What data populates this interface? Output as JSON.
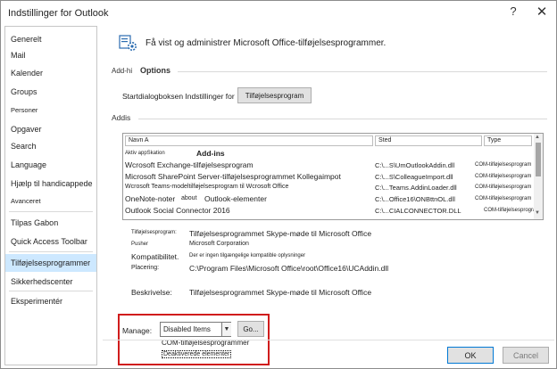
{
  "window": {
    "title": "Indstillinger for Outlook",
    "help_glyph": "?",
    "close_glyph": "✕"
  },
  "sidebar": {
    "items": [
      {
        "label": "Generelt"
      },
      {
        "label": "Mail"
      },
      {
        "label": "Kalender"
      },
      {
        "label": "Groups"
      },
      {
        "label": "Personer"
      },
      {
        "label": "Opgaver"
      },
      {
        "label": "Search"
      },
      {
        "label": "Language"
      },
      {
        "label": "Hjælp til handicappede"
      },
      {
        "label": "Avanceret"
      },
      {
        "label": "Tilpas Gabon"
      },
      {
        "label": "Quick Access Toolbar"
      },
      {
        "label": "Tilføjelsesprogrammer",
        "selected": true
      },
      {
        "label": "Sikkerhedscenter"
      },
      {
        "label": "Eksperimentér"
      }
    ]
  },
  "main": {
    "header": "Få vist og administrer Microsoft Office-tilføjelsesprogrammer.",
    "addin_section": {
      "prefix": "Add-hi",
      "label": "Options"
    },
    "startup": {
      "text": "Startdialogboksen Indstillinger for",
      "button_label": "Tilføjelsesprogram"
    },
    "addins_section_label": "Addis",
    "list": {
      "columns": {
        "name": "Navn A",
        "location": "Sted",
        "type": "Type"
      },
      "group": {
        "prefix": "Aktiv appSkation",
        "label": "Add-ins"
      },
      "rows": [
        {
          "name": "Wcrosoft Exchange-tilføjelsesprogram",
          "location": "C:\\...S\\UmOutlookAddin.dll",
          "type": "COM-tilføjelsesprogram"
        },
        {
          "name": "Microsoft SharePoint Server-tilføjelsesprogrammet Kollegaimpot",
          "location": "C:\\...S\\ColleagueImport.dll",
          "type": "COM-tilføjelsesprogram"
        },
        {
          "name": "Wcrosoft Teams-modeltilføjelsesprogram til Wcrosoft Office",
          "location": "C:\\...Teams.AddinLoader.dll",
          "type": "COM-tilføjelsesprogram"
        },
        {
          "name_prefix": "OneNote-noter",
          "name_mid": "about",
          "name_suffix": "Outlook-elementer",
          "location": "C:\\...Office16\\ONBttnOL.dll",
          "type": "COM-tilføjelsesprogram"
        },
        {
          "name": "Outlook Social Connector 2016",
          "location": "C:\\...CIALCONNECTOR.DLL",
          "type": "COM-tilføjelsesprogram"
        }
      ]
    },
    "details": {
      "top_line": "Tilføjelsesprogram:",
      "top_value": "Tilføjelsesprogrammet Skype-møde til Microsoft Office",
      "pusher_label": "Pusher",
      "pusher_value": "Microsoft Corporation",
      "compat_label": "Kompatibilitet.",
      "compat_value": "Der er ingen tilgængelige kompatible oplysninger",
      "location_label": "Placering:",
      "location_value": "C:\\Program Files\\Microsoft Office\\root\\Office16\\UCAddin.dll",
      "description_label": "Beskrivelse:",
      "description_value": "Tilføjelsesprogrammet Skype-møde til Microsoft Office"
    },
    "manage": {
      "label": "Manage:",
      "selected": "Disabled Items",
      "go_label": "Go...",
      "options": [
        "COM-tilføjelsesprogrammer",
        "Deaktiverede elementer"
      ]
    }
  },
  "footer": {
    "ok_label": "OK",
    "cancel_label": "Cancel"
  },
  "colors": {
    "accent": "#0078d4",
    "selection": "#cde8ff",
    "highlight_border": "#d01c1c",
    "icon_blue": "#2b6cb0"
  }
}
